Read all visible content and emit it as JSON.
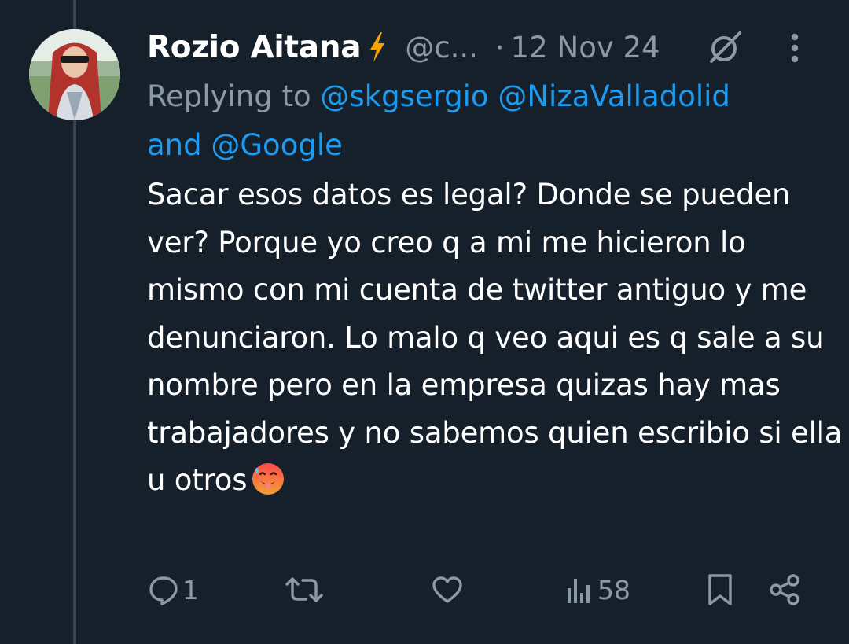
{
  "tweet": {
    "author_name": "Rozio Aitana",
    "author_badge_icon": "lightning-bolt-icon",
    "handle": "@c...",
    "separator": "·",
    "date": "12 Nov 24",
    "replying_prefix": "Replying to",
    "mentions": [
      "@skgsergio",
      "@NizaValladolid",
      "@Google"
    ],
    "mentions_joiner": "and",
    "body_text": "Sacar esos datos es legal? Donde se pueden ver? Porque yo creo q a mi me hicieron lo mismo con mi cuenta de twitter antiguo y me denunciaron. Lo malo q veo aqui es q sale a su nombre pero en la empresa quizas hay mas trabajadores y no sabemos quien escribio si ella u otros",
    "body_emoji": "hot-face-emoji"
  },
  "actions": {
    "reply_count": "1",
    "retweet_count": "",
    "like_count": "",
    "views_count": "58"
  },
  "colors": {
    "background": "#15202b",
    "secondary_text": "#8b98a5",
    "link": "#1d9bf0",
    "thread_line": "#38444d",
    "badge": "#f7a400"
  }
}
